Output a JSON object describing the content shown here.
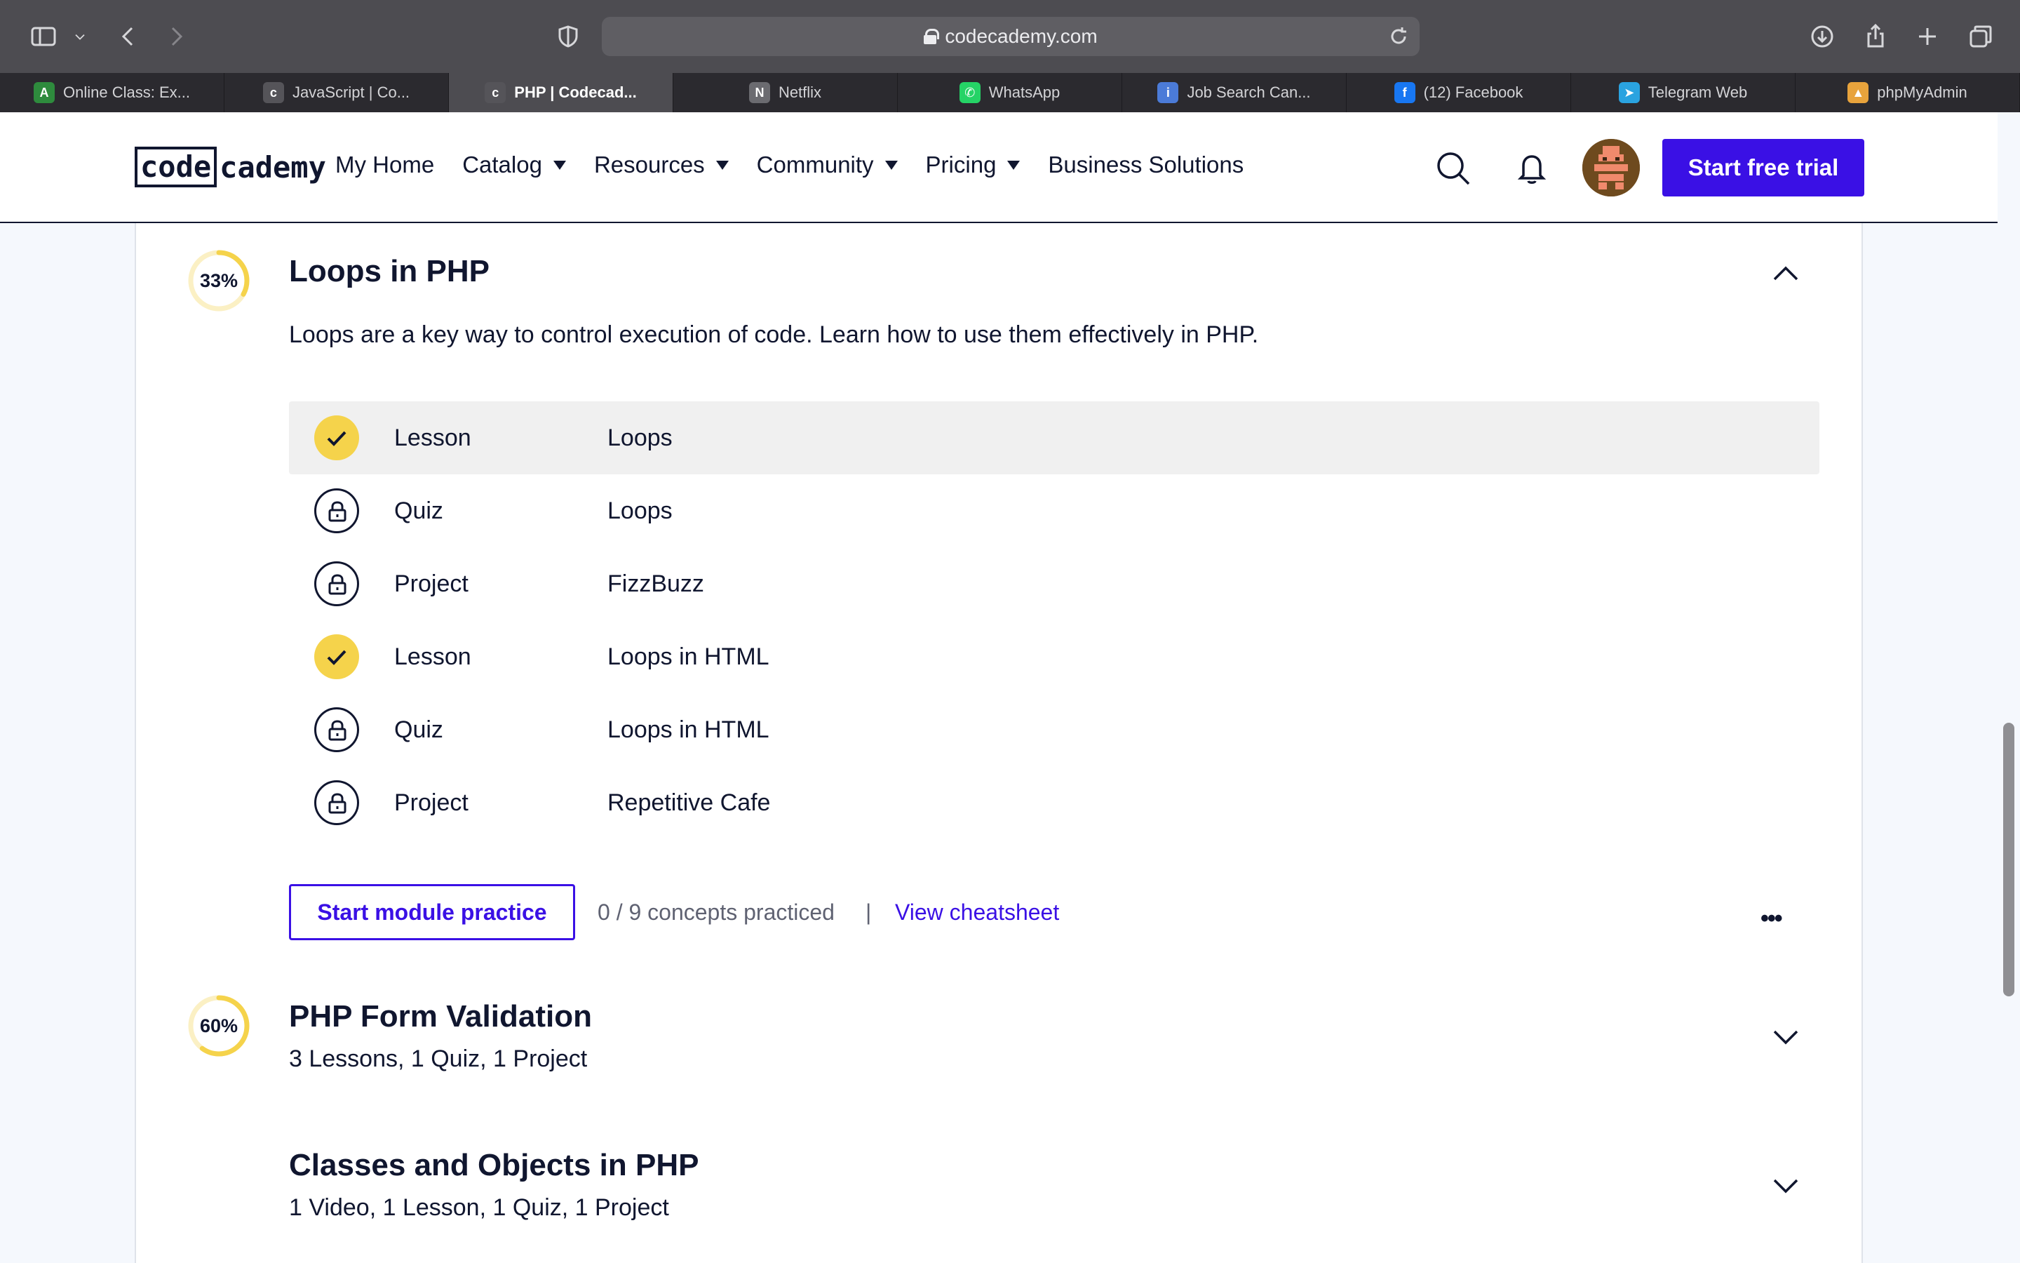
{
  "browser": {
    "url": "codecademy.com",
    "tabs": [
      {
        "label": "Online Class: Ex...",
        "color": "#2e8b3d",
        "glyph": "A"
      },
      {
        "label": "JavaScript | Co...",
        "color": "#555459",
        "glyph": "c"
      },
      {
        "label": "PHP | Codecad...",
        "color": "#555459",
        "glyph": "c",
        "active": true
      },
      {
        "label": "Netflix",
        "color": "#6b6b70",
        "glyph": "N"
      },
      {
        "label": "WhatsApp",
        "color": "#25d366",
        "glyph": "✆"
      },
      {
        "label": "Job Search Can...",
        "color": "#4b7bd8",
        "glyph": "i"
      },
      {
        "label": "(12) Facebook",
        "color": "#1877f2",
        "glyph": "f"
      },
      {
        "label": "Telegram Web",
        "color": "#2aa3e0",
        "glyph": "➤"
      },
      {
        "label": "phpMyAdmin",
        "color": "#e8a33c",
        "glyph": "▲"
      }
    ]
  },
  "header": {
    "logo_box": "code",
    "logo_rest": "cademy",
    "nav": [
      {
        "label": "My Home",
        "dropdown": false
      },
      {
        "label": "Catalog",
        "dropdown": true
      },
      {
        "label": "Resources",
        "dropdown": true
      },
      {
        "label": "Community",
        "dropdown": true
      },
      {
        "label": "Pricing",
        "dropdown": true
      },
      {
        "label": "Business Solutions",
        "dropdown": false
      }
    ],
    "cta": "Start free trial"
  },
  "module_loops": {
    "progress": 33,
    "progress_label": "33%",
    "title": "Loops in PHP",
    "description": "Loops are a key way to control execution of code. Learn how to use them effectively in PHP.",
    "items": [
      {
        "type": "Lesson",
        "name": "Loops",
        "status": "done"
      },
      {
        "type": "Quiz",
        "name": "Loops",
        "status": "locked"
      },
      {
        "type": "Project",
        "name": "FizzBuzz",
        "status": "locked"
      },
      {
        "type": "Lesson",
        "name": "Loops in HTML",
        "status": "done"
      },
      {
        "type": "Quiz",
        "name": "Loops in HTML",
        "status": "locked"
      },
      {
        "type": "Project",
        "name": "Repetitive Cafe",
        "status": "locked"
      }
    ],
    "practice_button": "Start module practice",
    "concepts": "0 / 9 concepts practiced",
    "separator": "|",
    "cheatsheet": "View cheatsheet",
    "more": "•••"
  },
  "module_forms": {
    "progress": 60,
    "progress_label": "60%",
    "title": "PHP Form Validation",
    "subtitle": "3 Lessons, 1 Quiz, 1 Project"
  },
  "module_classes": {
    "title": "Classes and Objects in PHP",
    "subtitle": "1 Video, 1 Lesson, 1 Quiz, 1 Project"
  },
  "colors": {
    "accent": "#3a10e5",
    "progress_ring": "#f5d34b",
    "ring_track": "#fbf0c4",
    "text": "#10162f"
  }
}
